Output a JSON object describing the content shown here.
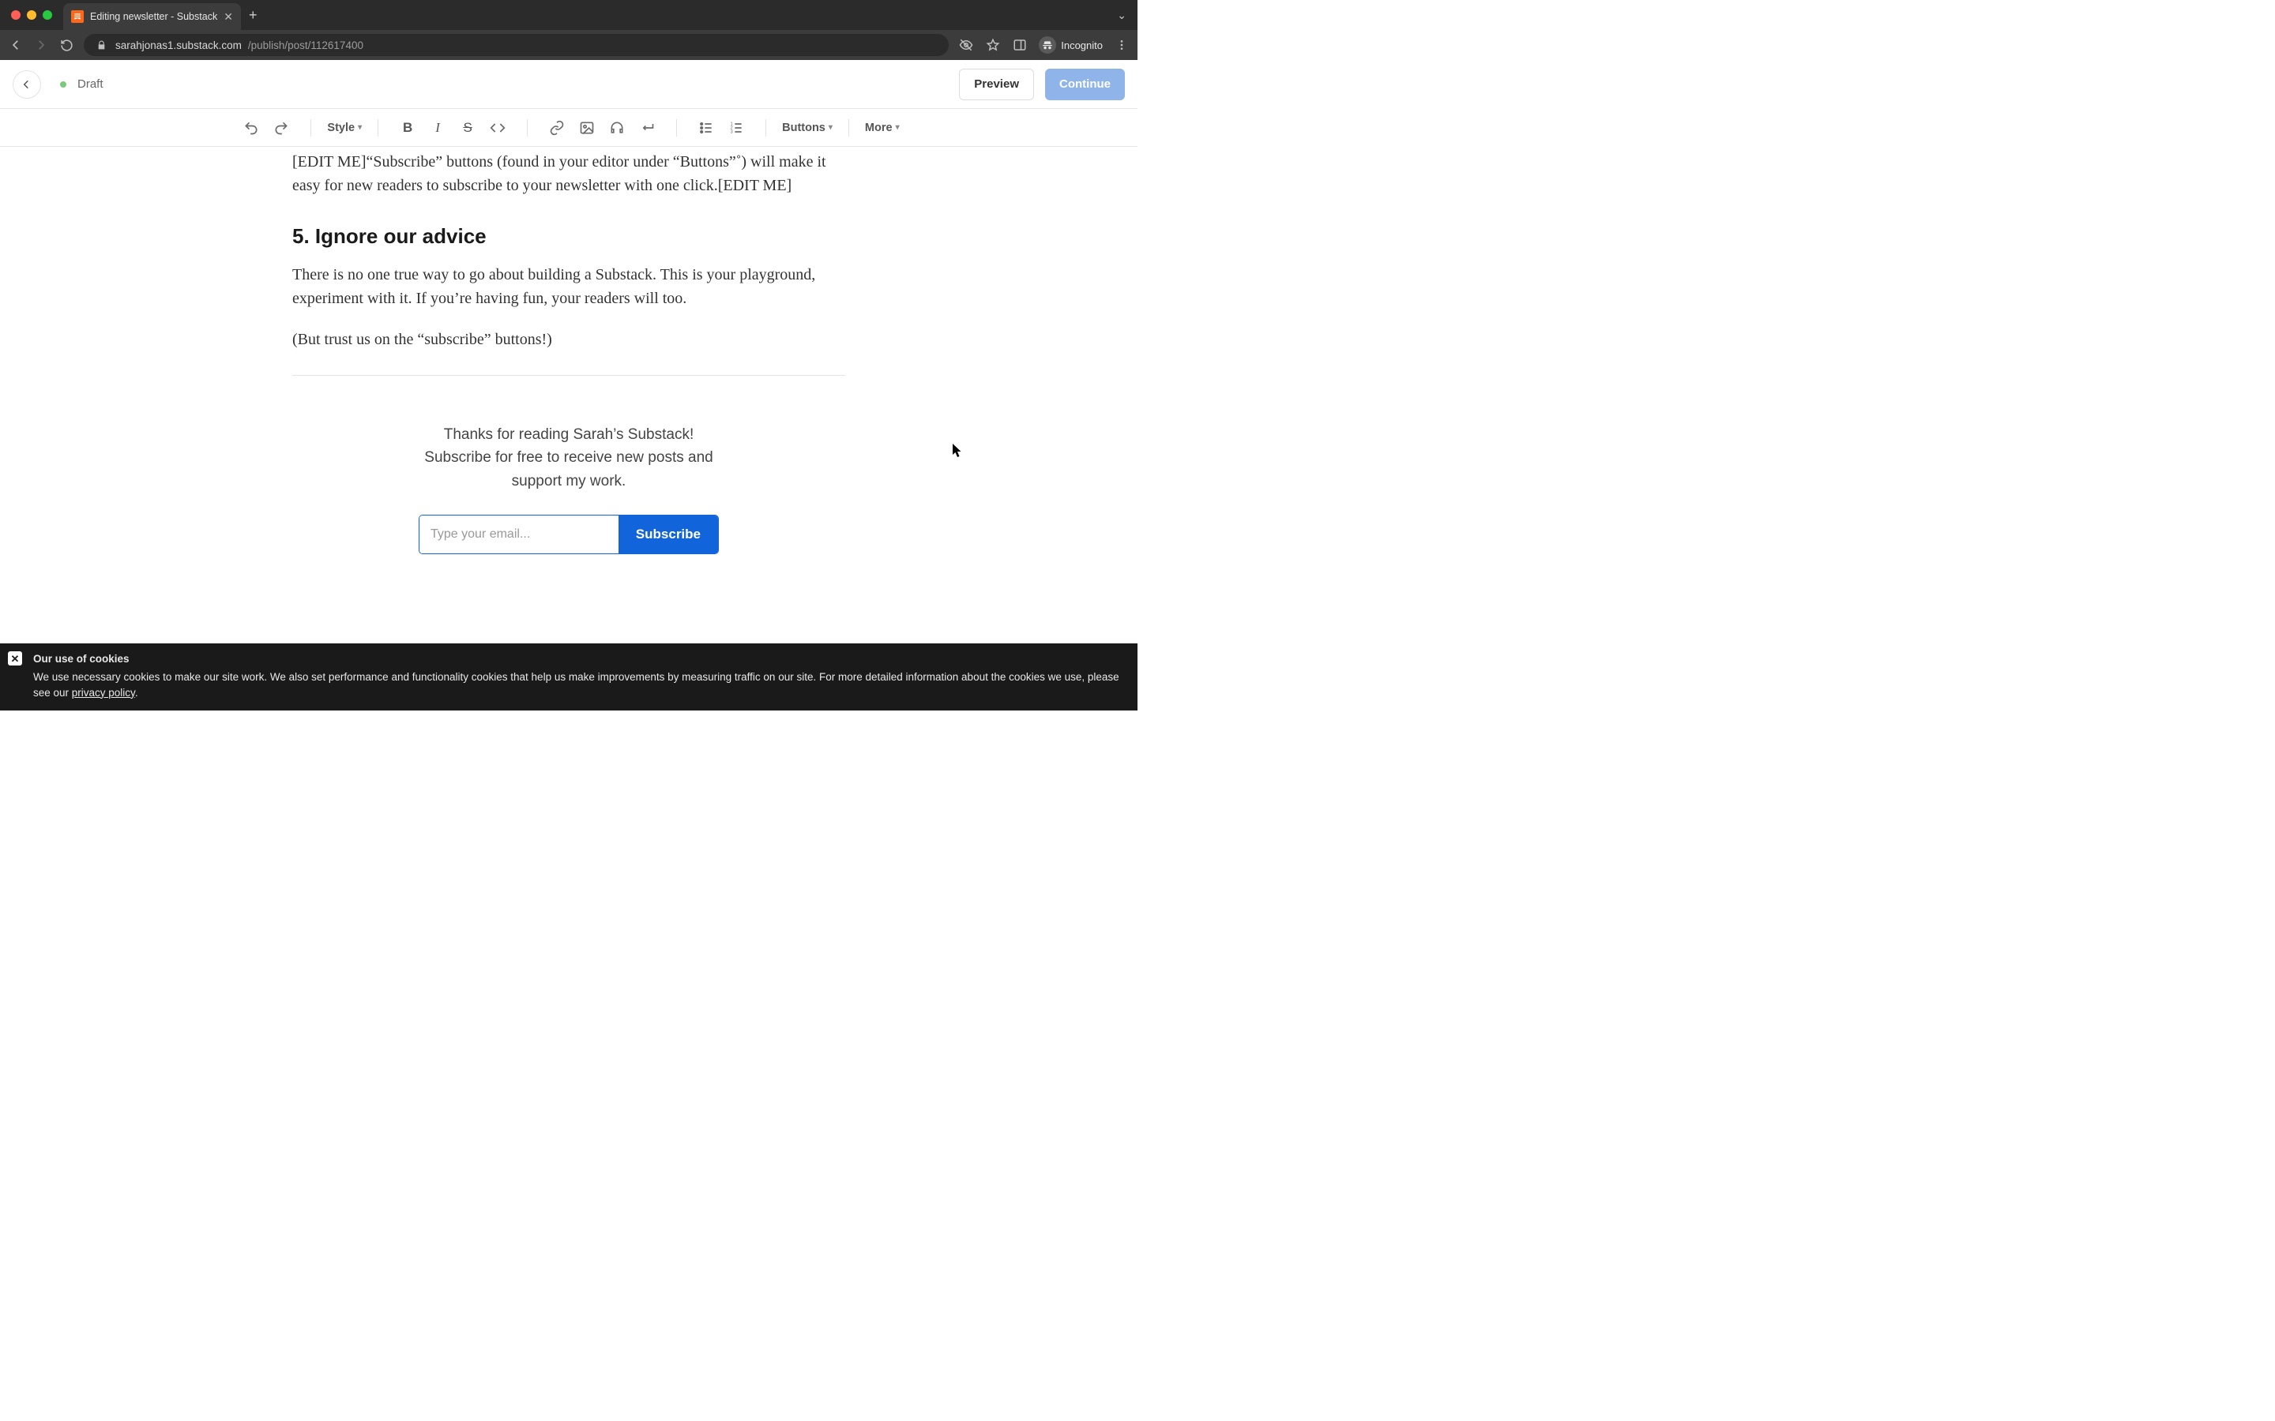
{
  "browser": {
    "tab_title": "Editing newsletter - Substack",
    "url_host": "sarahjonas1.substack.com",
    "url_path": "/publish/post/112617400",
    "incognito_label": "Incognito"
  },
  "header": {
    "status": "Draft",
    "preview_label": "Preview",
    "continue_label": "Continue"
  },
  "toolbar": {
    "style_label": "Style",
    "buttons_label": "Buttons",
    "more_label": "More"
  },
  "editor": {
    "para_intro": "[EDIT ME]“Subscribe” buttons (found in your editor under “Buttons”˚) will make it easy for new readers to subscribe to your newsletter with one click.[EDIT ME]",
    "heading5": "5. Ignore our advice",
    "para5a": "There is no one true way to go about building a Substack. This is your playground, experiment with it. If you’re having fun, your readers will too.",
    "para5b": "(But trust us on the “subscribe” buttons!)",
    "subscribe_message": "Thanks for reading Sarah’s Substack! Subscribe for free to receive new posts and support my work.",
    "email_placeholder": "Type your email...",
    "subscribe_button": "Subscribe"
  },
  "cookie": {
    "title": "Our use of cookies",
    "body_prefix": "We use necessary cookies to make our site work. We also set performance and functionality cookies that help us make improvements by measuring traffic on our site. For more detailed information about the cookies we use, please see our ",
    "link": "privacy policy",
    "body_suffix": "."
  }
}
